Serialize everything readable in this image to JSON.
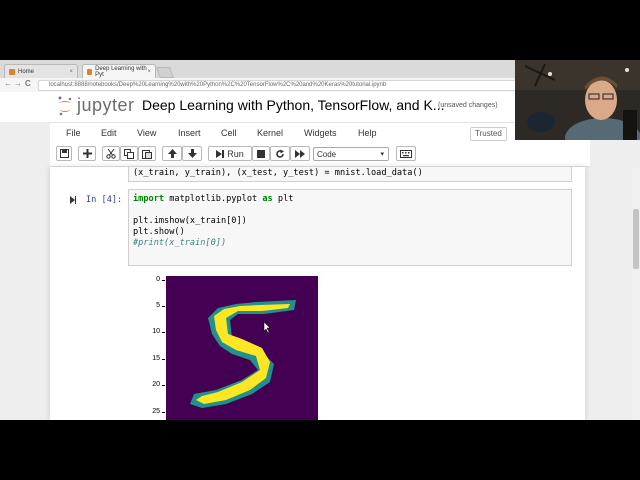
{
  "browser": {
    "tabs": [
      {
        "label": "Home",
        "close": "×"
      },
      {
        "label": "Deep Learning with Pyt",
        "close": "×"
      }
    ],
    "url": "localhost:8888/notebooks/Deep%20Learning%20with%20Python%2C%20TensorFlow%2C%20and%20Keras%20tutorial.ipynb",
    "back": "←",
    "forward": "→",
    "reload": "C"
  },
  "header": {
    "app_name": "jupyter",
    "notebook_title": "Deep Learning with Python, TensorFlow, and K...",
    "save_status": "(unsaved changes)"
  },
  "menu": {
    "items": [
      "File",
      "Edit",
      "View",
      "Insert",
      "Cell",
      "Kernel",
      "Widgets",
      "Help"
    ],
    "trusted": "Trusted"
  },
  "toolbar": {
    "run_label": "Run",
    "cell_type": "Code",
    "caret": "▾"
  },
  "prev_cell": {
    "code": "(x_train, y_train), (x_test, y_test) = mnist.load_data()"
  },
  "cell": {
    "prompt": "In [4]:",
    "line1_kw": "import",
    "line1_mid": " matplotlib.pyplot ",
    "line1_kw2": "as",
    "line1_end": " plt",
    "line2": "plt.imshow(x_train[0])",
    "line3": "plt.show()",
    "line4": "#print(x_train[0])"
  },
  "output": {
    "yticks": [
      "0",
      "5",
      "10",
      "15",
      "20",
      "25"
    ],
    "colors": {
      "background": "#440154",
      "foreground": "#fde725",
      "mid": "#21918c"
    }
  },
  "colors": {
    "prompt": "#303f9f",
    "keyword": "#008000",
    "comment": "#408080"
  }
}
